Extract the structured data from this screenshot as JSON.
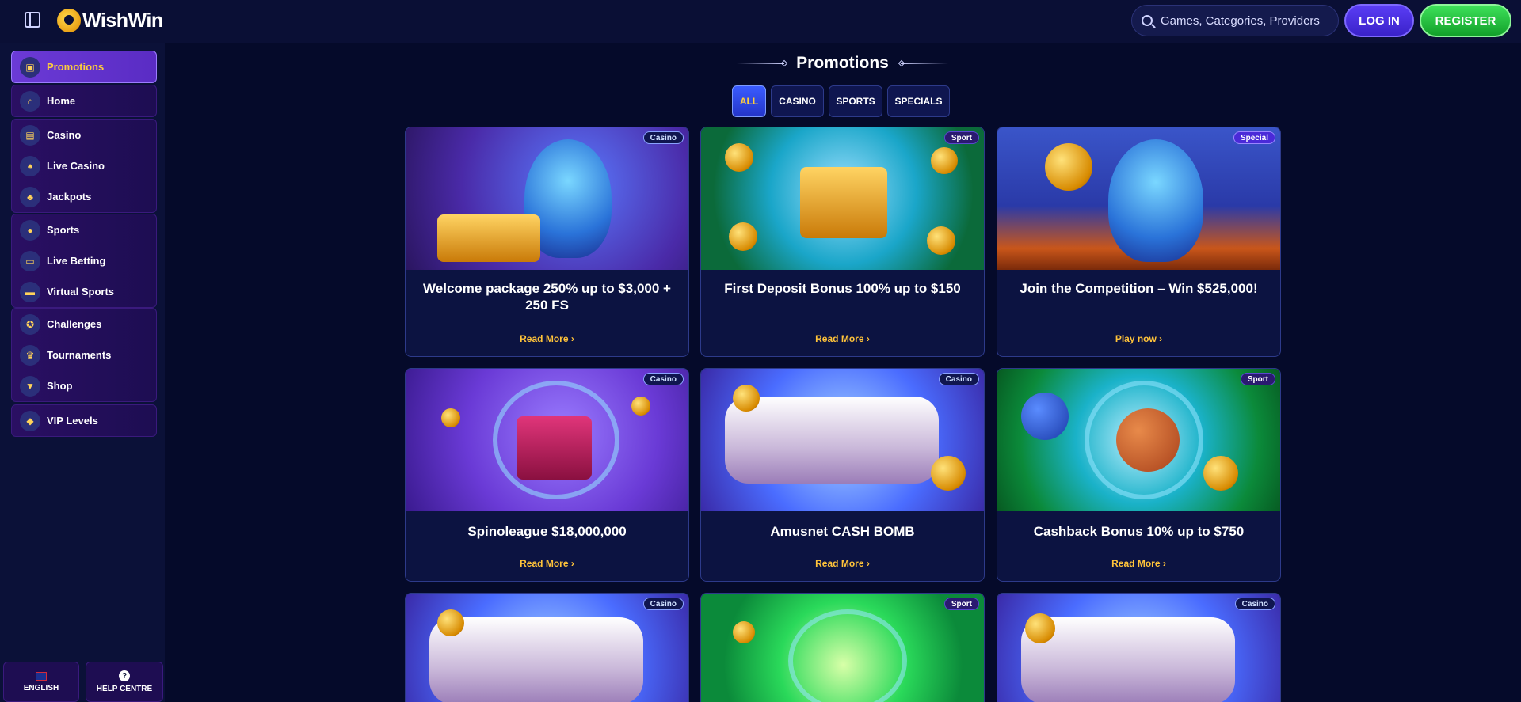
{
  "header": {
    "logo_text": "WishWin",
    "search_placeholder": "Games, Categories, Providers",
    "login_label": "LOG IN",
    "register_label": "REGISTER"
  },
  "sidebar": {
    "items": [
      {
        "label": "Promotions",
        "icon": "gift-icon",
        "active": true
      },
      {
        "label": "Home",
        "icon": "home-icon"
      },
      {
        "label": "Casino",
        "icon": "slot-machine-icon"
      },
      {
        "label": "Live Casino",
        "icon": "cards-icon"
      },
      {
        "label": "Jackpots",
        "icon": "clover-icon"
      },
      {
        "label": "Sports",
        "icon": "ball-icon"
      },
      {
        "label": "Live Betting",
        "icon": "live-icon"
      },
      {
        "label": "Virtual Sports",
        "icon": "monitor-icon"
      },
      {
        "label": "Challenges",
        "icon": "medal-icon"
      },
      {
        "label": "Tournaments",
        "icon": "trophy-icon"
      },
      {
        "label": "Shop",
        "icon": "basket-icon"
      },
      {
        "label": "VIP Levels",
        "icon": "diamond-icon"
      }
    ],
    "language_label": "ENGLISH",
    "help_label": "HELP CENTRE"
  },
  "main": {
    "title": "Promotions",
    "tabs": [
      {
        "label": "ALL",
        "active": true
      },
      {
        "label": "CASINO"
      },
      {
        "label": "SPORTS"
      },
      {
        "label": "SPECIALS"
      }
    ],
    "cards": [
      {
        "badge": "Casino",
        "title": "Welcome package 250% up to $3,000 + 250 FS",
        "link": "Read More"
      },
      {
        "badge": "Sport",
        "title": "First Deposit Bonus 100% up to $150",
        "link": "Read More"
      },
      {
        "badge": "Special",
        "title": "Join the Competition – Win $525,000!",
        "link": "Play now"
      },
      {
        "badge": "Casino",
        "title": "Spinoleague $18,000,000",
        "link": "Read More"
      },
      {
        "badge": "Casino",
        "title": "Amusnet CASH BOMB",
        "link": "Read More"
      },
      {
        "badge": "Sport",
        "title": "Cashback Bonus 10% up to $750",
        "link": "Read More"
      },
      {
        "badge": "Casino"
      },
      {
        "badge": "Sport"
      },
      {
        "badge": "Casino"
      }
    ]
  }
}
